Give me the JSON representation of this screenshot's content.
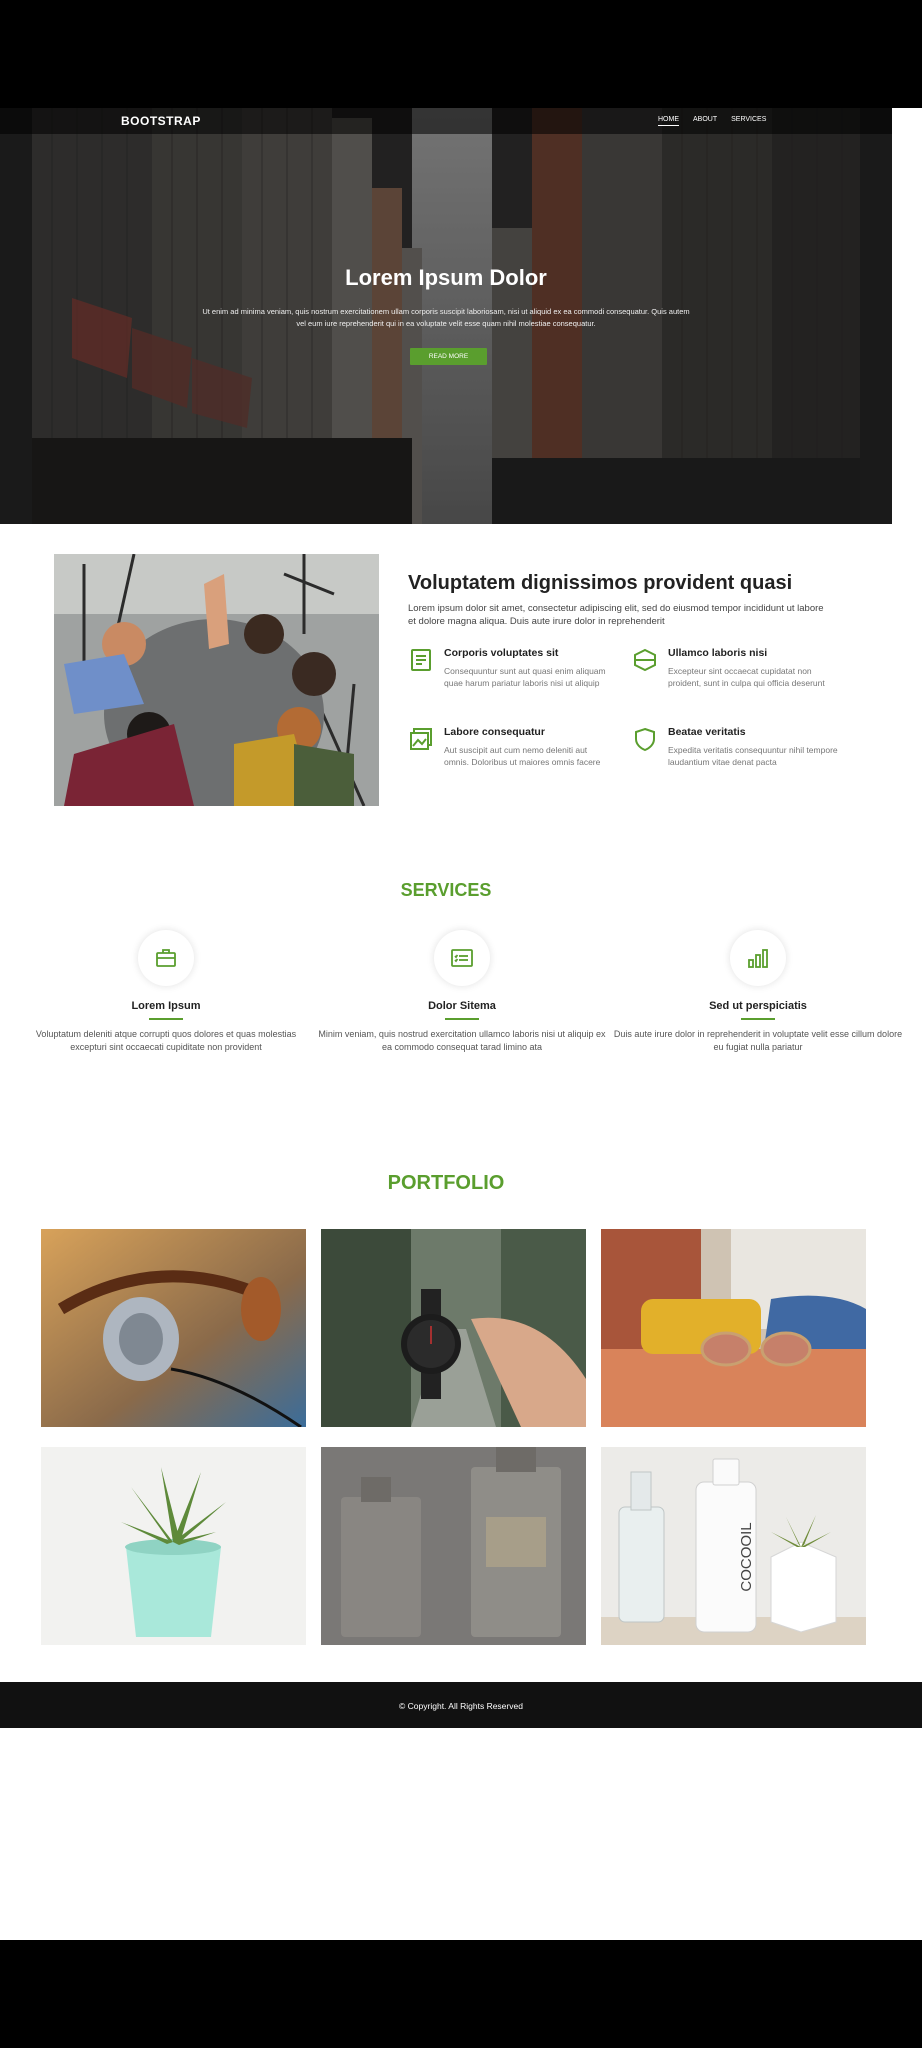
{
  "nav": {
    "brand": "BOOTSTRAP",
    "links": [
      "HOME",
      "ABOUT",
      "SERVICES"
    ]
  },
  "hero": {
    "title": "Lorem Ipsum Dolor",
    "text": "Ut enim ad minima veniam, quis nostrum exercitationem ullam corporis suscipit laboriosam, nisi ut aliquid ex ea commodi consequatur. Quis autem vel eum iure reprehenderit qui in ea voluptate velit esse quam nihil molestiae consequatur.",
    "button": "READ MORE"
  },
  "about": {
    "title": "Voluptatem dignissimos provident quasi",
    "text": "Lorem ipsum dolor sit amet, consectetur adipiscing elit, sed do eiusmod tempor incididunt ut labore et dolore magna aliqua. Duis aute irure dolor in reprehenderit",
    "features": [
      {
        "icon": "receipt-icon",
        "title": "Corporis voluptates sit",
        "text": "Consequuntur sunt aut quasi enim aliquam quae harum pariatur laboris nisi ut aliquip"
      },
      {
        "icon": "cube-icon",
        "title": "Ullamco laboris nisi",
        "text": "Excepteur sint occaecat cupidatat non proident, sunt in culpa qui officia deserunt"
      },
      {
        "icon": "images-icon",
        "title": "Labore consequatur",
        "text": "Aut suscipit aut cum nemo deleniti aut omnis. Doloribus ut maiores omnis facere"
      },
      {
        "icon": "shield-icon",
        "title": "Beatae veritatis",
        "text": "Expedita veritatis consequuntur nihil tempore laudantium vitae denat pacta"
      }
    ]
  },
  "services": {
    "heading": "SERVICES",
    "items": [
      {
        "icon": "briefcase-icon",
        "title": "Lorem Ipsum",
        "text": "Voluptatum deleniti atque corrupti quos dolores et quas molestias excepturi sint occaecati cupiditate non provident"
      },
      {
        "icon": "card-checklist-icon",
        "title": "Dolor Sitema",
        "text": "Minim veniam, quis nostrud exercitation ullamco laboris nisi ut aliquip ex ea commodo consequat tarad limino ata"
      },
      {
        "icon": "bar-chart-icon",
        "title": "Sed ut perspiciatis",
        "text": "Duis aute irure dolor in reprehenderit in voluptate velit esse cillum dolore eu fugiat nulla pariatur"
      }
    ]
  },
  "portfolio": {
    "heading": "PORTFOLIO",
    "items": [
      "headphones",
      "wristwatch",
      "sunglasses",
      "succulent-plant",
      "perfume-bottles",
      "cocooil-bottles"
    ],
    "bottle_label": "COCOOIL"
  },
  "footer": {
    "copyright": "© Copyright. All Rights Reserved"
  },
  "colors": {
    "accent": "#5a9e2e",
    "footer": "#111111"
  }
}
